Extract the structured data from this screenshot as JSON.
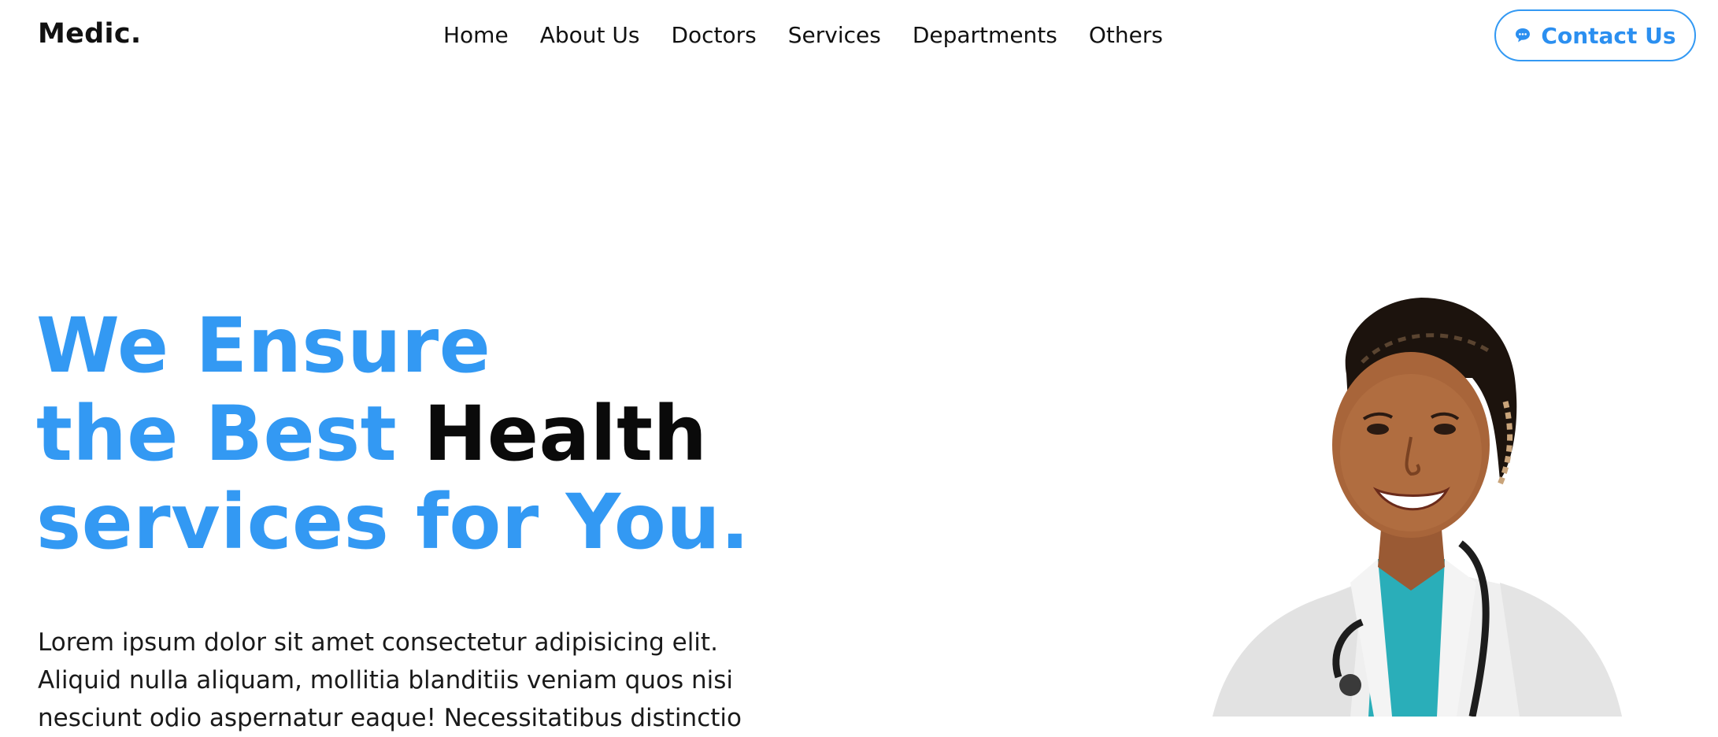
{
  "brand": {
    "logo": "Medic.",
    "accent_color": "#3399f3",
    "text_color": "#111111"
  },
  "nav": {
    "items": [
      "Home",
      "About Us",
      "Doctors",
      "Services",
      "Departments",
      "Others"
    ]
  },
  "contact_button": {
    "label": "Contact Us",
    "icon": "chat-bubble-icon"
  },
  "hero": {
    "title_line1": "We Ensure",
    "title_line2_accent": "the Best",
    "title_line2_dark": "Health",
    "title_line3": "services for You.",
    "description": "Lorem ipsum dolor sit amet consectetur adipisicing elit. Aliquid nulla aliquam, mollitia blanditiis veniam quos nisi nesciunt odio aspernatur eaque! Necessitatibus distinctio",
    "image": "doctor-portrait"
  }
}
